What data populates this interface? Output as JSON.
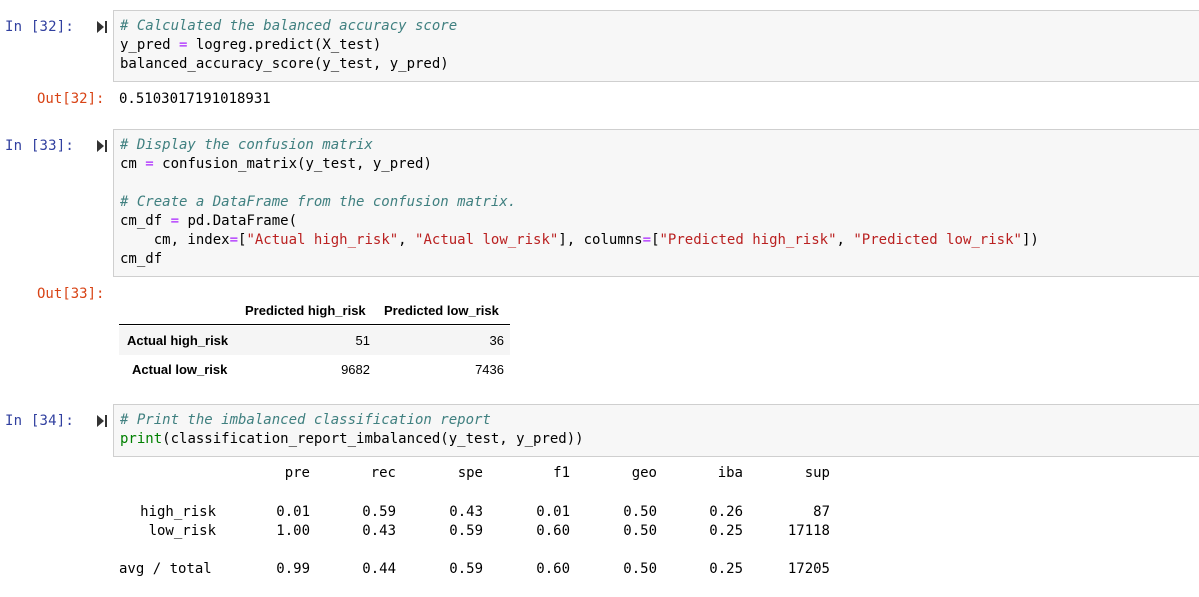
{
  "cells": {
    "c32": {
      "in_prompt": "In [32]:",
      "out_prompt": "Out[32]:",
      "code": {
        "l1_comment": "# Calculated the balanced accuracy score",
        "l2_a": "y_pred ",
        "l2_op": "=",
        "l2_b": " logreg.predict(X_test)",
        "l3": "balanced_accuracy_score(y_test, y_pred)"
      },
      "output": "0.5103017191018931"
    },
    "c33": {
      "in_prompt": "In [33]:",
      "out_prompt": "Out[33]:",
      "code": {
        "l1_comment": "# Display the confusion matrix",
        "l2_a": "cm ",
        "l2_op": "=",
        "l2_b": " confusion_matrix(y_test, y_pred)",
        "l4_comment": "# Create a DataFrame from the confusion matrix.",
        "l5_a": "cm_df ",
        "l5_op": "=",
        "l5_b": " pd.DataFrame(",
        "l6_a": "    cm, index",
        "l6_op1": "=",
        "l6_b": "[",
        "l6_s1": "\"Actual high_risk\"",
        "l6_c": ", ",
        "l6_s2": "\"Actual low_risk\"",
        "l6_d": "], columns",
        "l6_op2": "=",
        "l6_e": "[",
        "l6_s3": "\"Predicted high_risk\"",
        "l6_f": ", ",
        "l6_s4": "\"Predicted low_risk\"",
        "l6_g": "])",
        "l7": "cm_df"
      },
      "dataframe": {
        "columns": [
          "Predicted high_risk",
          "Predicted low_risk"
        ],
        "rows": [
          {
            "index": "Actual high_risk",
            "values": [
              "51",
              "36"
            ]
          },
          {
            "index": "Actual low_risk",
            "values": [
              "9682",
              "7436"
            ]
          }
        ]
      }
    },
    "c34": {
      "in_prompt": "In [34]:",
      "code": {
        "l1_comment": "# Print the imbalanced classification report",
        "l2_builtin": "print",
        "l2_b": "(classification_report_imbalanced(y_test, y_pred))"
      },
      "report": {
        "headers": [
          "pre",
          "rec",
          "spe",
          "f1",
          "geo",
          "iba",
          "sup"
        ],
        "rows": [
          {
            "label": "high_risk",
            "values": [
              "0.01",
              "0.59",
              "0.43",
              "0.01",
              "0.50",
              "0.26",
              "87"
            ]
          },
          {
            "label": "low_risk",
            "values": [
              "1.00",
              "0.43",
              "0.59",
              "0.60",
              "0.50",
              "0.25",
              "17118"
            ]
          },
          {
            "label": "avg / total",
            "values": [
              "0.99",
              "0.44",
              "0.59",
              "0.60",
              "0.50",
              "0.25",
              "17205"
            ]
          }
        ]
      }
    }
  },
  "icons": {
    "run": "run-cell-icon"
  },
  "colors": {
    "in_prompt": "#303f9f",
    "out_prompt": "#d84315",
    "comment": "#408080",
    "string": "#ba2121",
    "operator": "#aa22ff"
  }
}
